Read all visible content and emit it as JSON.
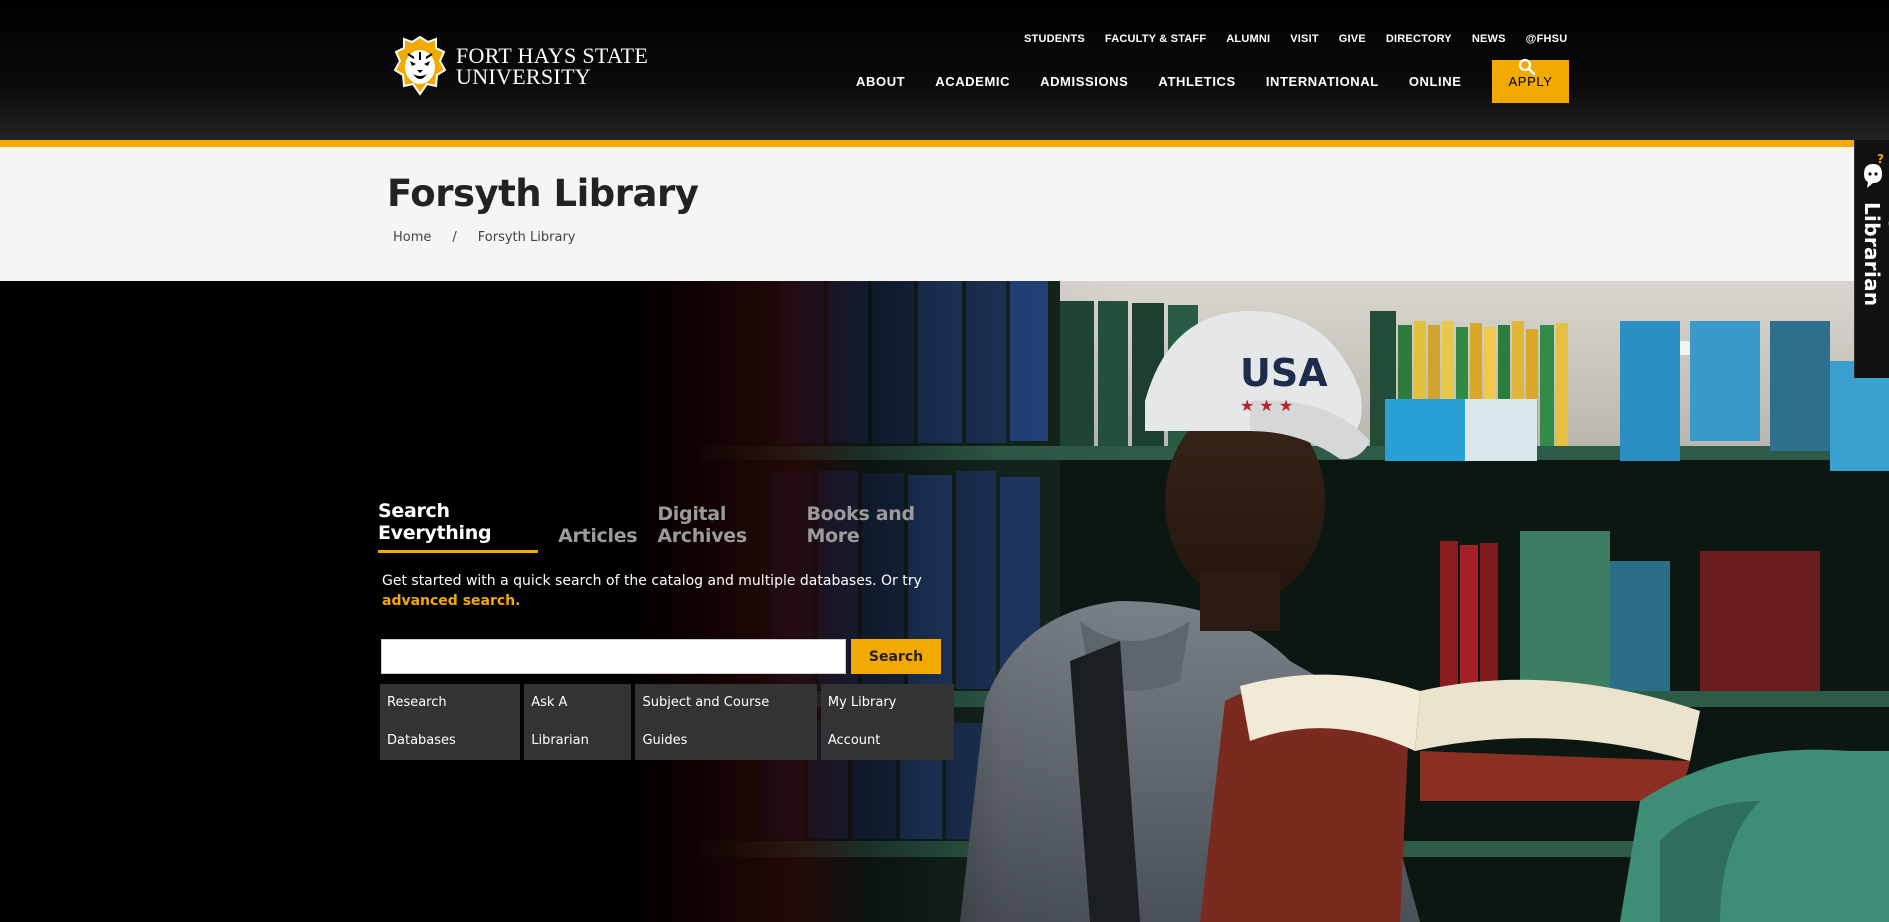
{
  "header": {
    "logo_line1": "FORT HAYS STATE",
    "logo_line2": "UNIVERSITY",
    "utility_nav": [
      "STUDENTS",
      "FACULTY & STAFF",
      "ALUMNI",
      "VISIT",
      "GIVE",
      "DIRECTORY",
      "NEWS",
      "@FHSU"
    ],
    "main_nav": [
      "ABOUT",
      "ACADEMIC",
      "ADMISSIONS",
      "ATHLETICS",
      "INTERNATIONAL",
      "ONLINE"
    ],
    "apply_label": "APPLY",
    "search_icon": "search-icon"
  },
  "page": {
    "title": "Forsyth Library",
    "breadcrumb": [
      "Home",
      "/",
      "Forsyth Library"
    ]
  },
  "search": {
    "tabs": [
      "Search Everything",
      "Articles",
      "Digital Archives",
      "Books and More"
    ],
    "active_tab": "Search Everything",
    "intro_text": "Get started with a quick search of the catalog and multiple databases. Or try ",
    "advanced_link": "advanced search.",
    "input_value": "",
    "button_label": "Search",
    "quick_links": [
      "Research Databases",
      "Ask A Librarian",
      "Subject and Course Guides",
      "My Library Account"
    ]
  },
  "ask_tab": {
    "label": "Ask A Librarian",
    "icon": "chat-question-icon"
  },
  "colors": {
    "accent": "#f2a900",
    "header_bg": "#000000",
    "title_band_bg": "#f5f5f5"
  }
}
